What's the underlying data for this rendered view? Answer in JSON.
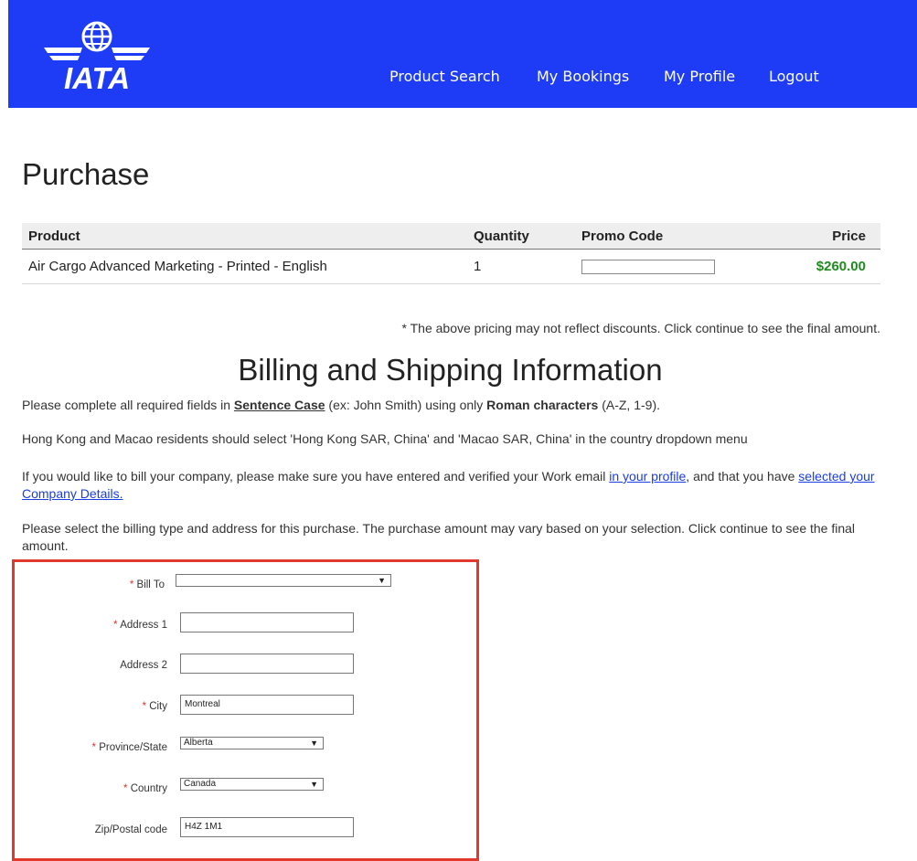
{
  "header": {
    "logo_text": "IATA",
    "bg_color": "#1e3cf5",
    "nav": [
      "Product Search",
      "My Bookings",
      "My Profile",
      "Logout"
    ]
  },
  "page_title": "Purchase",
  "products_table": {
    "headers": [
      "Product",
      "Quantity",
      "Promo Code",
      "Price"
    ],
    "rows": [
      {
        "product": "Air Cargo Advanced Marketing - Printed - English",
        "quantity": "1",
        "promo_code": "",
        "price": "$260.00"
      }
    ]
  },
  "disclaimer": "* The above pricing may not reflect discounts. Click continue to see the final amount.",
  "billing": {
    "title": "Billing and Shipping Information",
    "line1": {
      "prefix": "Please complete all required fields in ",
      "sentence_case": "Sentence Case",
      "middle": " (ex: John Smith) using only ",
      "roman": "Roman characters",
      "suffix": " (A-Z, 1-9)."
    },
    "line2": "Hong Kong and Macao residents should select 'Hong Kong SAR, China' and 'Macao SAR, China' in the country dropdown menu",
    "line3": {
      "prefix": "If you would like to bill your company, please make sure you have entered and verified your Work email ",
      "link1": "in your profile",
      "middle": ", and that you have ",
      "link2": "selected your Company Details."
    },
    "line4": "Please select the billing type and address for this purchase. The purchase amount may vary based on your selection. Click continue to see the final amount."
  },
  "form": {
    "required_mark": "*",
    "bill_to": {
      "label": "Bill To",
      "value": ""
    },
    "address1": {
      "label": "Address 1",
      "value": ""
    },
    "address2": {
      "label": "Address 2",
      "value": ""
    },
    "city": {
      "label": "City",
      "value": "Montreal"
    },
    "province": {
      "label": "Province/State",
      "value": "Alberta"
    },
    "country": {
      "label": "Country",
      "value": "Canada"
    },
    "zip": {
      "label": "Zip/Postal code",
      "value": "H4Z 1M1"
    },
    "dropdown_arrow": "▼"
  },
  "colors": {
    "accent": "#1e3cf5",
    "price": "#1f8a1f",
    "required": "#dd3333",
    "highlight": "#e03a2f",
    "link": "#1a3de0"
  }
}
